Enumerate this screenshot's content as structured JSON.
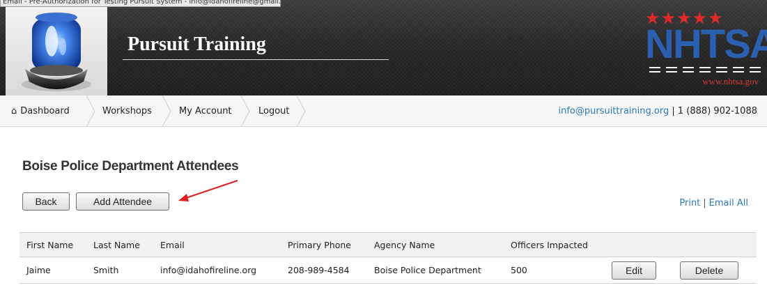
{
  "tooltip": {
    "text": "Email - Pre-Authorization for Testing Pursuit System - info@idahofireline@gmail.com"
  },
  "header": {
    "site_title": "Pursuit Training",
    "partner_logo": {
      "stars": "★★★★★",
      "name": "NHTSA",
      "url": "www.nhtsa.gov"
    },
    "logo_icon": "police-siren-light-icon"
  },
  "nav": {
    "items": [
      {
        "label": "Dashboard",
        "icon": "home-icon"
      },
      {
        "label": "Workshops"
      },
      {
        "label": "My Account"
      },
      {
        "label": "Logout"
      }
    ],
    "contact_email": "info@pursuittraining.org",
    "contact_separator": "|",
    "contact_phone": "1 (888) 902-1088"
  },
  "page": {
    "heading": "Boise Police Department Attendees",
    "back_label": "Back",
    "add_label": "Add Attendee",
    "print_label": "Print",
    "links_separator": "|",
    "email_all_label": "Email All"
  },
  "table": {
    "headers": [
      "First Name",
      "Last Name",
      "Email",
      "Primary Phone",
      "Agency Name",
      "Officers Impacted"
    ],
    "rows": [
      {
        "first_name": "Jaime",
        "last_name": "Smith",
        "email": "info@idahofireline.org",
        "phone": "208-989-4584",
        "agency": "Boise Police Department",
        "officers": "500",
        "edit_label": "Edit",
        "delete_label": "Delete"
      }
    ]
  },
  "colors": {
    "link": "#2a7bc0",
    "annotation_arrow": "#e02020",
    "banner": "#262626"
  }
}
